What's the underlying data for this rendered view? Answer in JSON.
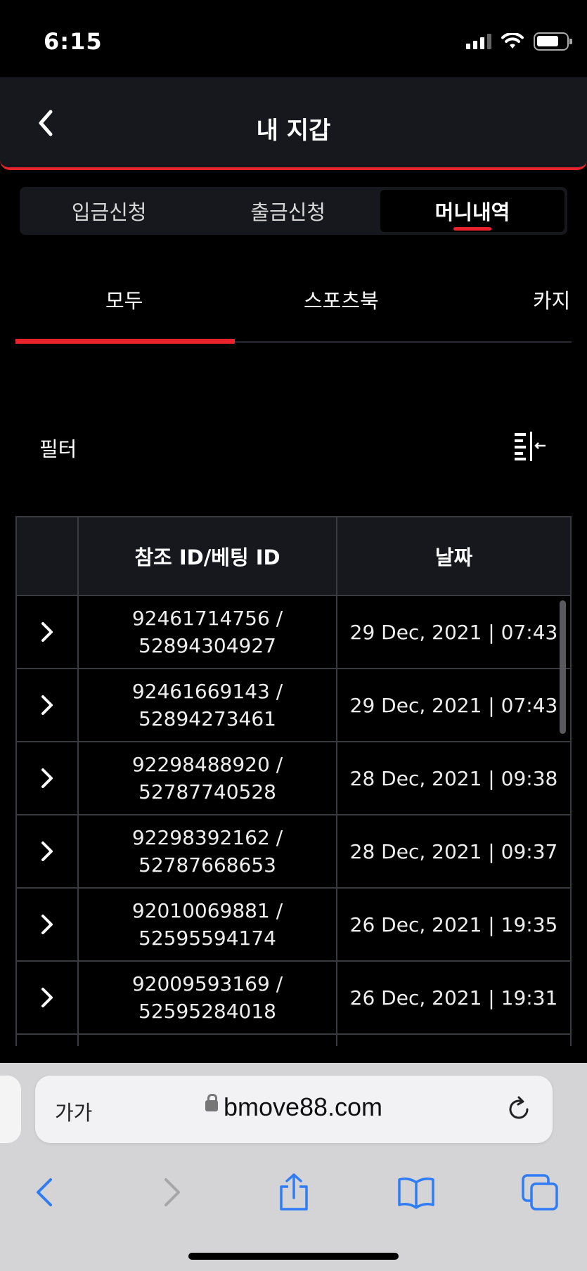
{
  "status": {
    "time": "6:15"
  },
  "header": {
    "title": "내 지갑"
  },
  "segments": [
    "입금신청",
    "출금신청",
    "머니내역"
  ],
  "subtabs": [
    "모두",
    "스포츠북",
    "카지"
  ],
  "filter": {
    "label": "필터"
  },
  "table": {
    "headers": [
      "",
      "참조 ID/베팅 ID",
      "날짜"
    ],
    "rows": [
      {
        "ref": "92461714756 /",
        "bet": "52894304927",
        "date": "29 Dec, 2021 | 07:43"
      },
      {
        "ref": "92461669143 /",
        "bet": "52894273461",
        "date": "29 Dec, 2021 | 07:43"
      },
      {
        "ref": "92298488920 /",
        "bet": "52787740528",
        "date": "28 Dec, 2021 | 09:38"
      },
      {
        "ref": "92298392162 /",
        "bet": "52787668653",
        "date": "28 Dec, 2021 | 09:37"
      },
      {
        "ref": "92010069881 /",
        "bet": "52595594174",
        "date": "26 Dec, 2021 | 19:35"
      },
      {
        "ref": "92009593169 /",
        "bet": "52595284018",
        "date": "26 Dec, 2021 | 19:31"
      }
    ]
  },
  "browser": {
    "text_size": "가가",
    "url": "bmove88.com"
  },
  "colors": {
    "accent": "#e8232b",
    "ios_blue": "#2f7cf6"
  }
}
